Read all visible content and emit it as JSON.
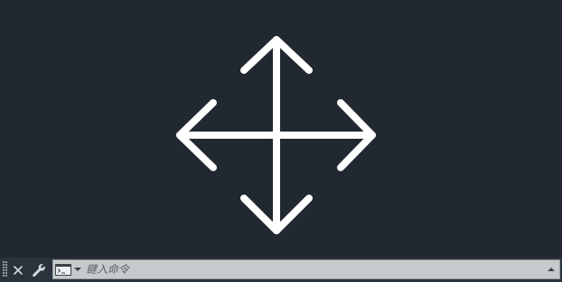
{
  "canvas": {
    "background": "#212830",
    "cursor_icon": "move-cursor-icon",
    "cursor_color": "#ffffff"
  },
  "command_line": {
    "placeholder": "鍵入命令",
    "close_icon": "close-icon",
    "settings_icon": "wrench-icon",
    "history_icon": "command-prompt-icon",
    "expand_icon": "caret-up-icon",
    "input_background": "#c7cacd"
  }
}
